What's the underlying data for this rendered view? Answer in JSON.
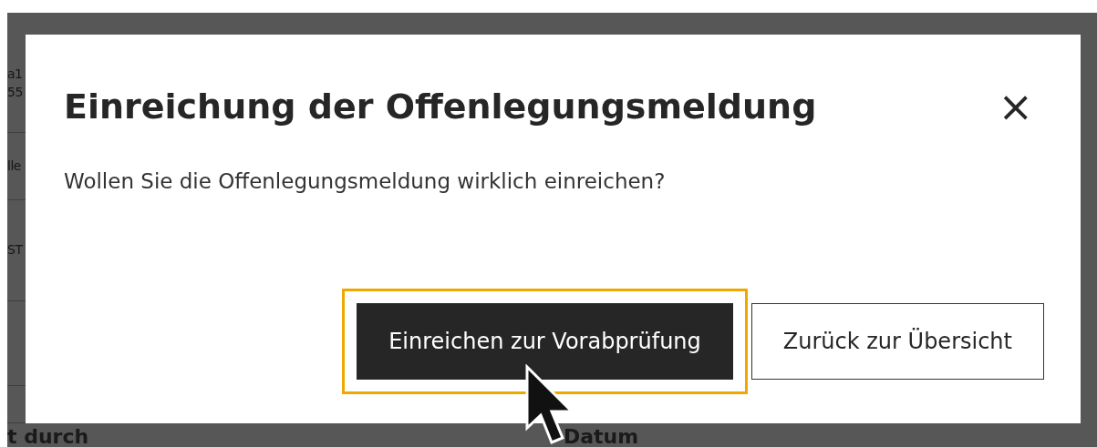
{
  "background": {
    "left_cells": [
      [
        "a1",
        "55"
      ],
      [
        "lle"
      ],
      [
        "ST"
      ],
      [],
      []
    ],
    "bottom_row": [
      "t durch",
      "Datum"
    ]
  },
  "dialog": {
    "title": "Einreichung der Offenlegungsmeldung",
    "close": "×",
    "message": "Wollen Sie die Offenlegungsmeldung wirklich einreichen?",
    "buttons": [
      {
        "label": "Einreichen zur Vorabprüfung",
        "kind": "primary",
        "focused": true
      },
      {
        "label": "Zurück zur Übersicht",
        "kind": "secondary",
        "focused": false
      }
    ]
  }
}
